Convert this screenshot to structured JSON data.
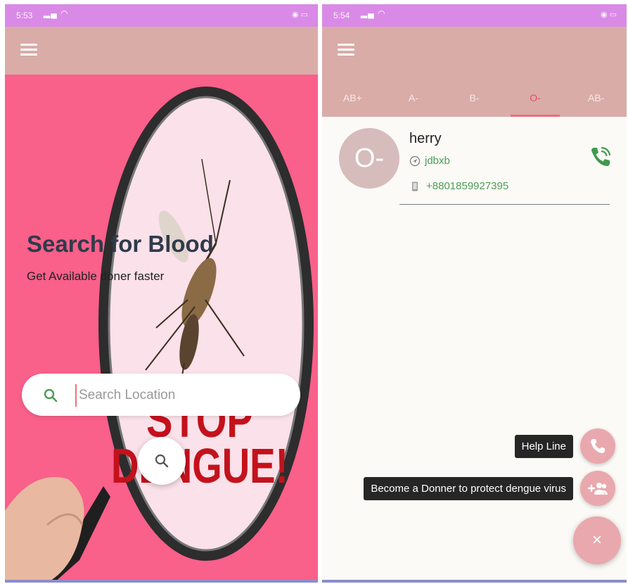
{
  "left": {
    "status_time": "5:53",
    "hero_title": "Search for Blood",
    "hero_subtitle": "Get Available doner faster",
    "search_placeholder": "Search Location",
    "poster_line1": "STOP",
    "poster_line2": "DENGUE!",
    "colors": {
      "status_bar": "#d98ae6",
      "appbar": "#d9aca8",
      "hero_bg": "#f9608a",
      "title": "#2f3b4a"
    }
  },
  "right": {
    "status_time": "5:54",
    "tabs": [
      {
        "label": "AB+",
        "active": false
      },
      {
        "label": "A-",
        "active": false
      },
      {
        "label": "B-",
        "active": false
      },
      {
        "label": "O-",
        "active": true
      },
      {
        "label": "AB-",
        "active": false
      }
    ],
    "donor": {
      "blood_group": "O-",
      "name": "herry",
      "location": "jdbxb",
      "phone": "+8801859927395"
    },
    "fab_actions": [
      {
        "label": "Help Line",
        "icon": "phone-icon"
      },
      {
        "label": "Become a Donner to protect dengue virus",
        "icon": "add-group-icon"
      }
    ],
    "fab_close": "×",
    "colors": {
      "accent": "#e84a5f",
      "fab": "#e9a8ad",
      "green": "#4d9c58"
    }
  }
}
